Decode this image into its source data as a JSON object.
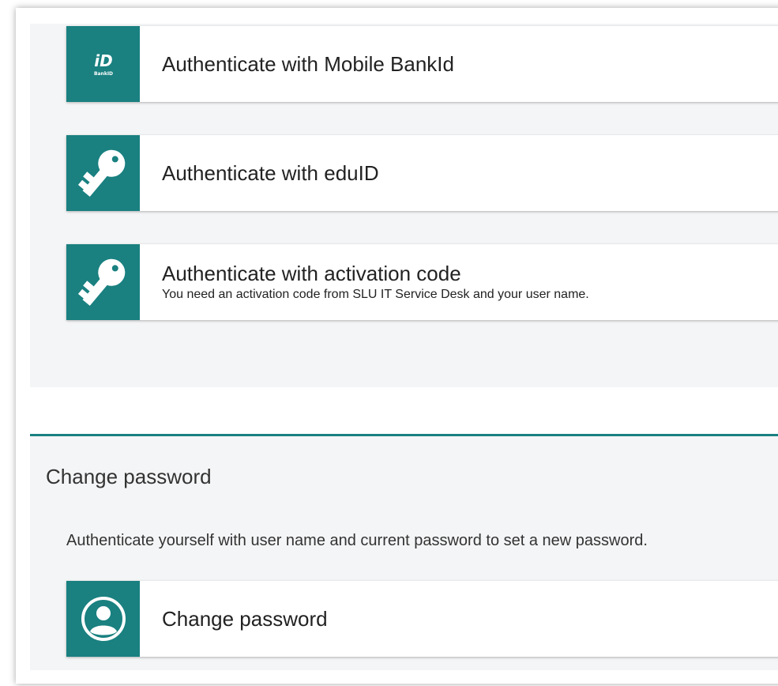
{
  "auth_options": [
    {
      "title": "Authenticate with Mobile BankId",
      "subtitle": "",
      "icon": "bankid-logo-icon",
      "logo_text": "BankID"
    },
    {
      "title": "Authenticate with eduID",
      "subtitle": "",
      "icon": "key-icon"
    },
    {
      "title": "Authenticate with activation code",
      "subtitle": "You need an activation code from SLU IT Service Desk and your user name.",
      "icon": "key-icon"
    }
  ],
  "change_password": {
    "section_title": "Change password",
    "description": "Authenticate yourself with user name and current password to set a new password.",
    "button_label": "Change password",
    "icon": "user-circle-icon"
  },
  "colors": {
    "accent": "#1a8080",
    "panel_background": "#f4f5f6",
    "card_background": "#ffffff"
  }
}
